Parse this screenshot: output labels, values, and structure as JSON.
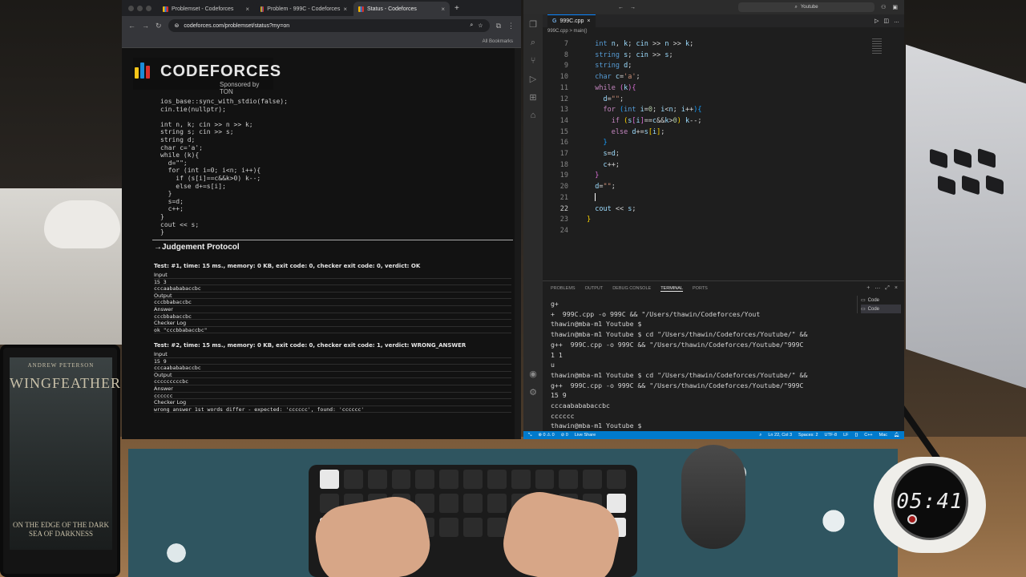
{
  "browser": {
    "tabs": [
      {
        "label": "Problemset - Codeforces"
      },
      {
        "label": "Problem - 999C - Codeforces"
      },
      {
        "label": "Status - Codeforces"
      }
    ],
    "url": "codeforces.com/problemset/status?my=on",
    "bookmarks_label": "All Bookmarks",
    "logo_text": "CODEFORCES",
    "sponsor": "Sponsored by TON",
    "code_lines": [
      "ios_base::sync_with_stdio(false);",
      "cin.tie(nullptr);",
      "",
      "int n, k; cin >> n >> k;",
      "string s; cin >> s;",
      "string d;",
      "char c='a';",
      "while (k){",
      "  d=\"\";",
      "  for (int i=0; i<n; i++){",
      "    if (s[i]==c&&k>0) k--;",
      "    else d+=s[i];",
      "  }",
      "  s=d;",
      "  c++;",
      "}",
      "cout << s;",
      "}"
    ],
    "judgement_title": "→Judgement Protocol",
    "tests": [
      {
        "header": "Test: #1, time: 15 ms., memory: 0 KB, exit code: 0, checker exit code: 0, verdict: OK",
        "lines": [
          "Input",
          "15 3",
          "cccaabababaccbc",
          "Output",
          "cccbbabaccbc",
          "Answer",
          "cccbbabaccbc",
          "Checker Log",
          "ok \"cccbbabaccbc\""
        ]
      },
      {
        "header": "Test: #2, time: 15 ms., memory: 0 KB, exit code: 0, checker exit code: 1, verdict: WRONG_ANSWER",
        "lines": [
          "Input",
          "15 9",
          "cccaabababaccbc",
          "Output",
          "cccccc\u0000ccbc",
          "Answer",
          "cccccc",
          "Checker Log",
          "wrong answer 1st words differ - expected: 'cccccc', found: 'cccccc'"
        ]
      }
    ]
  },
  "vscode": {
    "search_text": "Youtube",
    "tab_label": "999C.cpp",
    "breadcrumb": "999C.cpp > main()",
    "line_numbers": [
      "7",
      "8",
      "9",
      "10",
      "11",
      "12",
      "13",
      "14",
      "15",
      "16",
      "17",
      "18",
      "19",
      "20",
      "21",
      "22",
      "23",
      "24"
    ],
    "current_line": "22",
    "panel_tabs": [
      "PROBLEMS",
      "OUTPUT",
      "DEBUG CONSOLE",
      "TERMINAL",
      "PORTS"
    ],
    "active_panel_tab": "TERMINAL",
    "terminal_lines": [
      "g+",
      "+  999C.cpp -o 999C && \"/Users/thawin/Codeforces/Yout",
      "thawin@mba-m1 Youtube $",
      "thawin@mba-m1 Youtube $ cd \"/Users/thawin/Codeforces/Youtube/\" &&",
      "g++  999C.cpp -o 999C && \"/Users/thawin/Codeforces/Youtube/\"999C",
      "1 1",
      "u",
      "thawin@mba-m1 Youtube $ cd \"/Users/thawin/Codeforces/Youtube/\" &&",
      "g++  999C.cpp -o 999C && \"/Users/thawin/Codeforces/Youtube/\"999C",
      "15 9",
      "cccaabababaccbc",
      "cccccc",
      "thawin@mba-m1 Youtube $"
    ],
    "terminal_list": [
      "Code",
      "Code"
    ],
    "status": {
      "left": [
        "⊗ 0 ⚠ 0",
        "⊘ 0",
        "Live Share"
      ],
      "right": [
        "Ln 22, Col 3",
        "Spaces: 2",
        "UTF-8",
        "LF",
        "C++",
        "Mac"
      ]
    }
  },
  "scene": {
    "clock_time": "05:41",
    "book_author": "ANDREW PETERSON",
    "book_title": "WINGFEATHER",
    "book_subtitle": "ON THE EDGE OF THE DARK SEA OF DARKNESS",
    "book_device": "kindle"
  }
}
